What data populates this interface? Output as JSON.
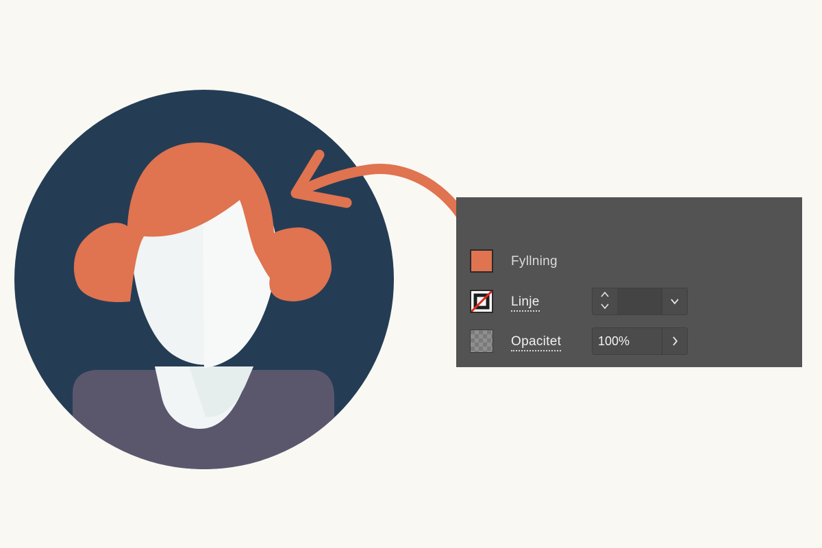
{
  "colors": {
    "background": "#faf8f3",
    "circle": "#243d55",
    "hair": "#e07350",
    "face": "#f4f6f6",
    "shirt": "#5a576d",
    "panel": "#535353",
    "arrow": "#e07350"
  },
  "panel": {
    "fill": {
      "label": "Fyllning",
      "swatch_color": "#e07350",
      "swatch_icon": "fill-swatch-icon"
    },
    "stroke": {
      "label": "Linje",
      "swatch_icon": "no-stroke-swatch-icon",
      "value": ""
    },
    "opacity": {
      "label": "Opacitet",
      "value": "100%",
      "swatch_icon": "checkerboard-icon"
    }
  }
}
